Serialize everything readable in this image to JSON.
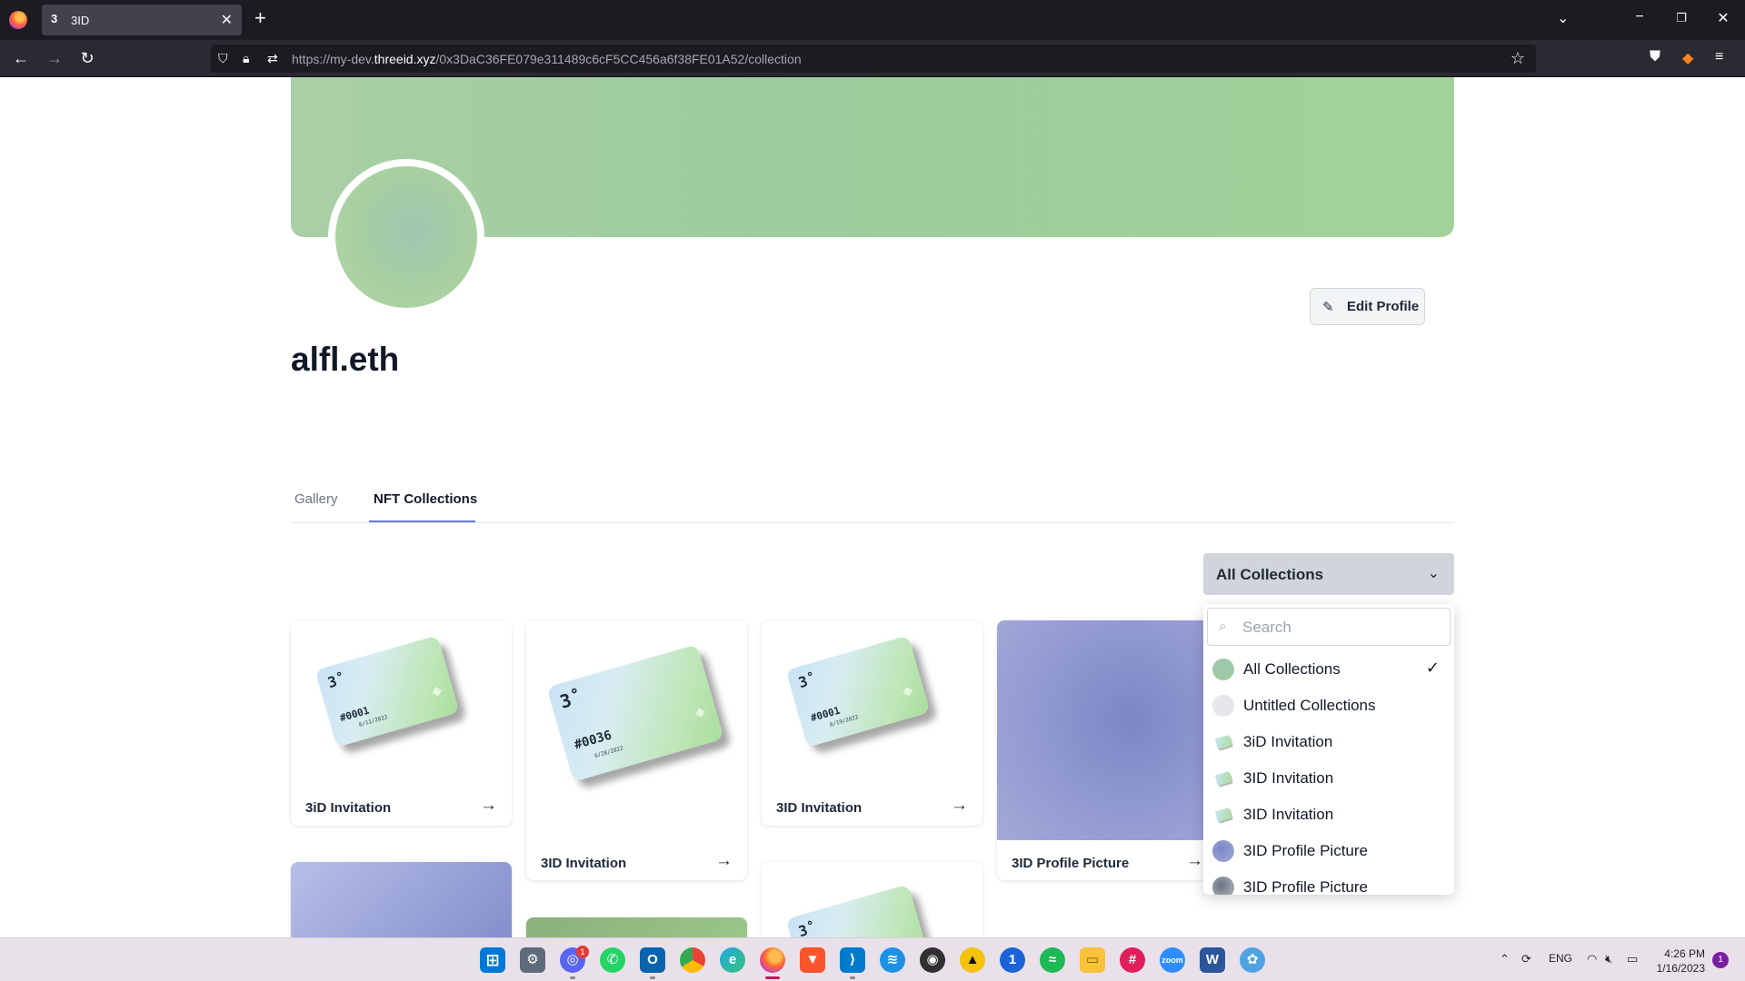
{
  "browser": {
    "tab_title": "3ID",
    "tab_icon": "3",
    "url_prefix": "https://my-dev.",
    "url_domain": "threeid.xyz",
    "url_path": "/0x3DaC36FE079e311489c6cF5CC456a6f38FE01A52/collection",
    "new_tab": "+",
    "close": "✕"
  },
  "profile": {
    "username": "alfl.eth",
    "edit_button": "Edit Profile",
    "banner_color": "#9ccd9c"
  },
  "tabs": [
    {
      "label": "Gallery",
      "active": false
    },
    {
      "label": "NFT Collections",
      "active": true
    }
  ],
  "collection_select": {
    "selected": "All Collections"
  },
  "cards": [
    {
      "title": "3iD Invitation",
      "nft_number": "#0001",
      "nft_date": "8/11/2022"
    },
    {
      "title": "3ID Invitation",
      "nft_number": "#0036",
      "nft_date": "6/28/2022"
    },
    {
      "title": "3ID Invitation",
      "nft_number": "#0001",
      "nft_date": "8/19/2022"
    },
    {
      "title": "3ID Profile Picture"
    }
  ],
  "card_arrow": "→",
  "dropdown": {
    "search_placeholder": "Search",
    "items": [
      {
        "label": "All Collections",
        "selected": true,
        "icon": "gradient-green",
        "color": "#9ccd9c"
      },
      {
        "label": "Untitled Collections",
        "selected": false,
        "icon": "gray-circle",
        "color": "#e5e7eb"
      },
      {
        "label": "3iD Invitation",
        "selected": false,
        "icon": "nft-thumb"
      },
      {
        "label": "3ID Invitation",
        "selected": false,
        "icon": "nft-thumb"
      },
      {
        "label": "3ID Invitation",
        "selected": false,
        "icon": "nft-thumb"
      },
      {
        "label": "3ID Profile Picture",
        "selected": false,
        "icon": "gradient-purple",
        "color": "#8b93cf"
      },
      {
        "label": "3ID Profile Picture",
        "selected": false,
        "icon": "gradient-gray",
        "color": "#9ca3af"
      }
    ],
    "check": "✓"
  },
  "taskbar": {
    "language": "ENG",
    "time": "4:26 PM",
    "date": "1/16/2023",
    "notifications": "1",
    "discord_badge": "1"
  }
}
